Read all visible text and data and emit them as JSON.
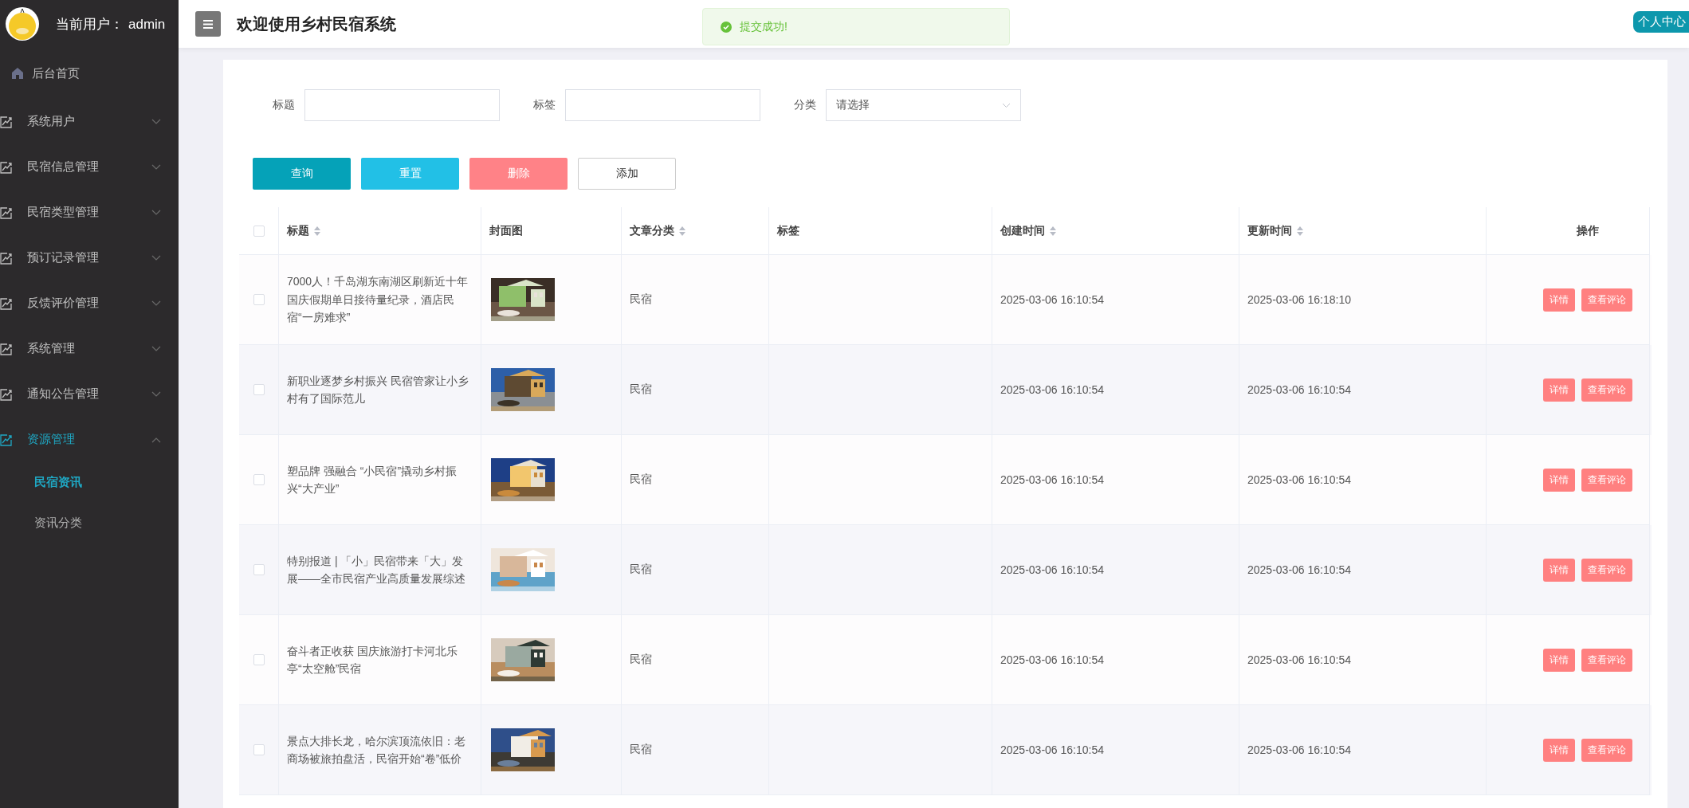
{
  "sidebar": {
    "user_label": "当前用户：",
    "username": "admin",
    "items": [
      {
        "kind": "home",
        "label": "后台首页"
      },
      {
        "kind": "menu",
        "label": "系统用户",
        "expanded": false
      },
      {
        "kind": "menu",
        "label": "民宿信息管理",
        "expanded": false
      },
      {
        "kind": "menu",
        "label": "民宿类型管理",
        "expanded": false
      },
      {
        "kind": "menu",
        "label": "预订记录管理",
        "expanded": false
      },
      {
        "kind": "menu",
        "label": "反馈评价管理",
        "expanded": false
      },
      {
        "kind": "menu",
        "label": "系统管理",
        "expanded": false
      },
      {
        "kind": "menu",
        "label": "通知公告管理",
        "expanded": false
      },
      {
        "kind": "menu",
        "label": "资源管理",
        "expanded": true,
        "children": [
          {
            "label": "民宿资讯",
            "selected": true
          },
          {
            "label": "资讯分类",
            "selected": false
          }
        ]
      }
    ]
  },
  "header": {
    "title": "欢迎使用乡村民宿系统",
    "profile_button": "个人中心"
  },
  "toast": {
    "message": "提交成功!"
  },
  "filters": [
    {
      "kind": "text",
      "label": "标题"
    },
    {
      "kind": "text",
      "label": "标签"
    },
    {
      "kind": "select",
      "label": "分类",
      "placeholder": "请选择"
    }
  ],
  "buttons": [
    {
      "kind": "primary",
      "label": "查询"
    },
    {
      "kind": "info",
      "label": "重置"
    },
    {
      "kind": "danger",
      "label": "删除"
    },
    {
      "kind": "plain",
      "label": "添加"
    }
  ],
  "table": {
    "all_checked": false,
    "columns": [
      {
        "label": "标题",
        "sortable": true
      },
      {
        "label": "封面图",
        "sortable": false
      },
      {
        "label": "文章分类",
        "sortable": true
      },
      {
        "label": "标签",
        "sortable": false
      },
      {
        "label": "创建时间",
        "sortable": true
      },
      {
        "label": "更新时间",
        "sortable": true
      },
      {
        "label": "操作",
        "sortable": false
      }
    ],
    "rows": [
      {
        "checked": false,
        "title": "7000人！千岛湖东南湖区刷新近十年国庆假期单日接待量纪录，酒店民宿“一房难求”",
        "cover": {
          "kind": "picture"
        },
        "category": "民宿",
        "created": "2025-03-06 16:10:54",
        "updated": "2025-03-06 16:18:10",
        "actions": [
          "详情",
          "查看评论"
        ]
      },
      {
        "checked": false,
        "title": "新职业逐梦乡村振兴 民宿管家让小乡村有了国际范儿",
        "cover": {
          "kind": "picture"
        },
        "category": "民宿",
        "created": "2025-03-06 16:10:54",
        "updated": "2025-03-06 16:10:54",
        "actions": [
          "详情",
          "查看评论"
        ]
      },
      {
        "checked": false,
        "title": "塑品牌 强融合 “小民宿”撬动乡村振兴“大产业”",
        "cover": {
          "kind": "picture"
        },
        "category": "民宿",
        "created": "2025-03-06 16:10:54",
        "updated": "2025-03-06 16:10:54",
        "actions": [
          "详情",
          "查看评论"
        ]
      },
      {
        "checked": false,
        "title": "特别报道 | 「小」民宿带来「大」发展——全市民宿产业高质量发展综述",
        "cover": {
          "kind": "picture"
        },
        "category": "民宿",
        "created": "2025-03-06 16:10:54",
        "updated": "2025-03-06 16:10:54",
        "actions": [
          "详情",
          "查看评论"
        ]
      },
      {
        "checked": false,
        "title": "奋斗者正收获 国庆旅游打卡河北乐亭“太空舱”民宿",
        "cover": {
          "kind": "picture"
        },
        "category": "民宿",
        "created": "2025-03-06 16:10:54",
        "updated": "2025-03-06 16:10:54",
        "actions": [
          "详情",
          "查看评论"
        ]
      },
      {
        "checked": false,
        "title": "景点大排长龙，哈尔滨顶流依旧：老商场被旅拍盘活，民宿开始“卷”低价",
        "cover": {
          "kind": "picture"
        },
        "category": "民宿",
        "created": "2025-03-06 16:10:54",
        "updated": "2025-03-06 16:10:54",
        "actions": [
          "详情",
          "查看评论"
        ]
      }
    ]
  }
}
